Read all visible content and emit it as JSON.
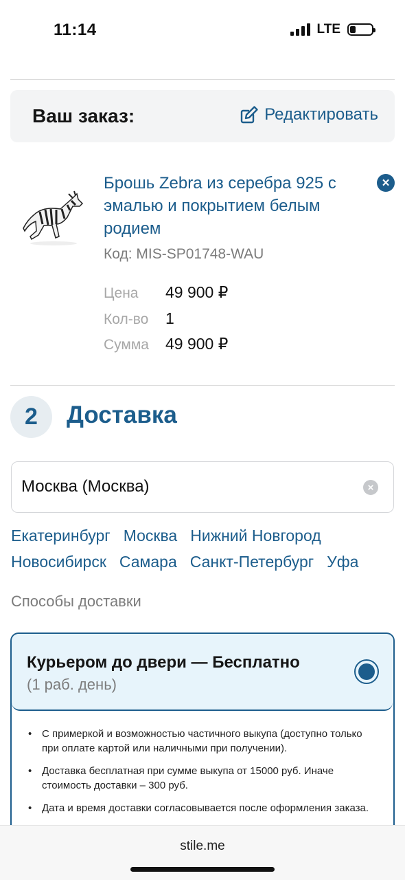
{
  "status": {
    "time": "11:14",
    "network": "LTE"
  },
  "order": {
    "title": "Ваш заказ:",
    "edit_label": "Редактировать"
  },
  "product": {
    "name": "Брошь Zebra из серебра 925 с эмалью и покрытием белым родием",
    "code": "Код: MIS-SP01748-WAU",
    "price_label": "Цена",
    "price_value": "49 900 ₽",
    "qty_label": "Кол-во",
    "qty_value": "1",
    "sum_label": "Сумма",
    "sum_value": "49 900 ₽"
  },
  "delivery": {
    "step": "2",
    "title": "Доставка",
    "city_value": "Москва (Москва)",
    "cities": [
      "Екатеринбург",
      "Москва",
      "Нижний Новгород",
      "Новосибирск",
      "Самара",
      "Санкт-Петербург",
      "Уфа"
    ],
    "methods_label": "Способы доставки",
    "option": {
      "title": "Курьером до двери — Бесплатно",
      "subtitle": "(1 раб. день)",
      "details": [
        "С примеркой и возможностью частичного выкупа (доступно только при оплате картой или наличными при получении).",
        "Доставка бесплатная при сумме выкупа от 15000 руб. Иначе стоимость доставки – 300 руб.",
        "Дата и время доставки согласовывается после оформления заказа."
      ]
    }
  },
  "browser": {
    "url": "stile.me"
  },
  "colors": {
    "accent": "#1c5d8c",
    "option_bg": "#e7f4fb",
    "header_bg": "#f3f4f5"
  }
}
